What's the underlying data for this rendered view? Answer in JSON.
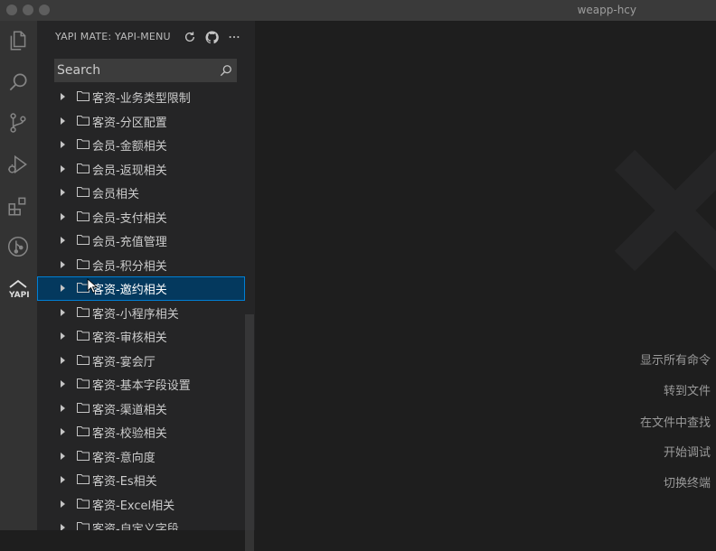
{
  "window": {
    "title": "weapp-hcy"
  },
  "activity_bar": {
    "items": [
      {
        "name": "explorer-icon"
      },
      {
        "name": "search-icon"
      },
      {
        "name": "source-control-icon"
      },
      {
        "name": "run-debug-icon"
      },
      {
        "name": "extensions-icon"
      },
      {
        "name": "git-graph-icon"
      },
      {
        "name": "yapi-icon",
        "text": "YAPI"
      }
    ]
  },
  "sidebar": {
    "title": "YAPI MATE: YAPI-MENU",
    "actions": [
      "refresh-icon",
      "github-icon",
      "more-icon"
    ],
    "search": {
      "placeholder": "Search",
      "value": ""
    },
    "items": [
      {
        "label": "客资-业务类型限制"
      },
      {
        "label": "客资-分区配置"
      },
      {
        "label": "会员-金额相关"
      },
      {
        "label": "会员-返现相关"
      },
      {
        "label": "会员相关"
      },
      {
        "label": "会员-支付相关"
      },
      {
        "label": "会员-充值管理"
      },
      {
        "label": "会员-积分相关"
      },
      {
        "label": "客资-邀约相关",
        "selected": true
      },
      {
        "label": "客资-小程序相关"
      },
      {
        "label": "客资-审核相关"
      },
      {
        "label": "客资-宴会厅"
      },
      {
        "label": "客资-基本字段设置"
      },
      {
        "label": "客资-渠道相关"
      },
      {
        "label": "客资-校验相关"
      },
      {
        "label": "客资-意向度"
      },
      {
        "label": "客资-Es相关"
      },
      {
        "label": "客资-Excel相关"
      },
      {
        "label": "客资-自定义字段"
      }
    ]
  },
  "editor": {
    "commands": [
      "显示所有命令",
      "转到文件",
      "在文件中查找",
      "开始调试",
      "切换终端"
    ]
  },
  "colors": {
    "selected_bg": "#04395e",
    "selected_border": "#007fd4",
    "sidebar_bg": "#252526",
    "activity_bar_bg": "#333333",
    "editor_bg": "#1e1e1e"
  }
}
